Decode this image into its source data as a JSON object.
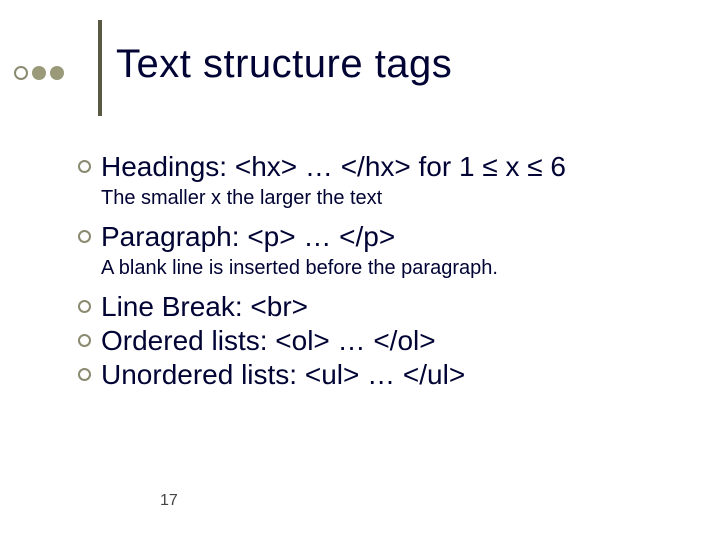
{
  "title": "Text structure tags",
  "items": [
    {
      "main": "Headings: <hx> … </hx> for 1 ≤ x ≤ 6",
      "sub": "The smaller x the larger the text"
    },
    {
      "main": "Paragraph: <p> … </p>",
      "sub": "A blank line is inserted before the paragraph."
    },
    {
      "main": "Line Break: <br>",
      "sub": null
    },
    {
      "main": "Ordered lists: <ol> … </ol>",
      "sub": null
    },
    {
      "main": "Unordered lists: <ul> … </ul>",
      "sub": null
    }
  ],
  "page_number": "17"
}
